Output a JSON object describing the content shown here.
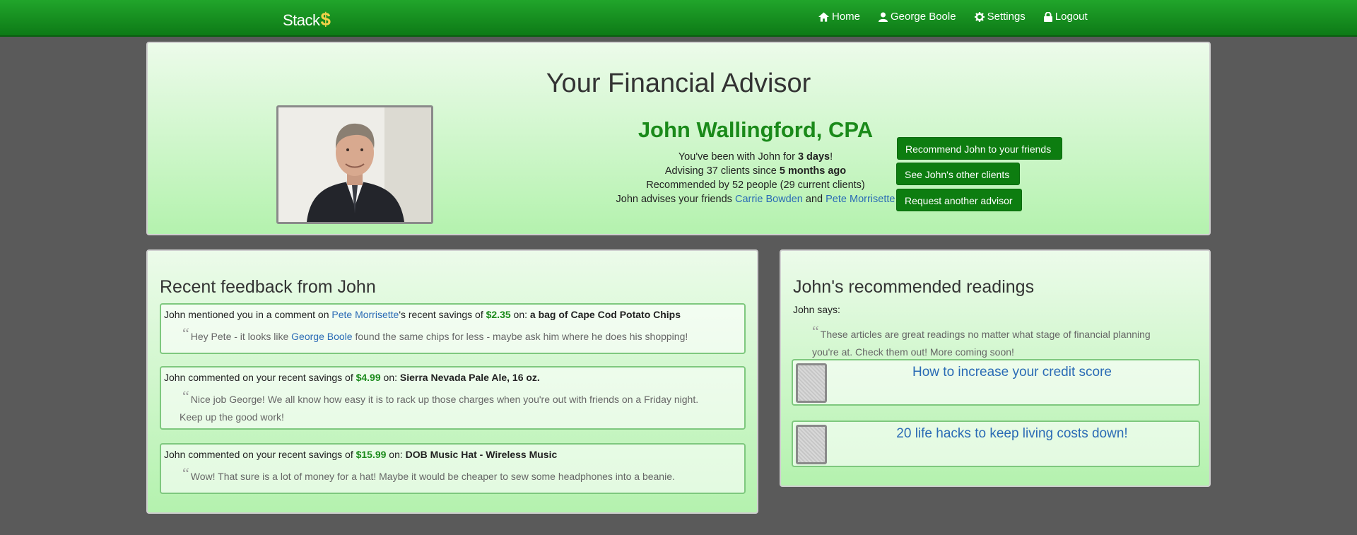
{
  "nav": {
    "brand_text": "Stack",
    "brand_symbol": "$",
    "items": [
      {
        "label": "Home",
        "icon": "home-icon"
      },
      {
        "label": "George Boole",
        "icon": "user-icon"
      },
      {
        "label": "Settings",
        "icon": "gear-icon"
      },
      {
        "label": "Logout",
        "icon": "lock-icon"
      }
    ]
  },
  "hero": {
    "title": "Your Financial Advisor",
    "advisor_name": "John Wallingford, CPA",
    "line1_pre": "You've been with John for ",
    "line1_bold": "3 days",
    "line1_post": "!",
    "line2_pre": "Advising 37 clients since ",
    "line2_bold": "5 months ago",
    "line3": "Recommended by 52 people (29 current clients)",
    "line4_pre": "John advises your friends ",
    "friend1": "Carrie Bowden",
    "line4_and": " and ",
    "friend2": "Pete Morrisette",
    "buttons": {
      "recommend": "Recommend John to your friends",
      "other_clients": "See John's other clients",
      "request": "Request another advisor"
    }
  },
  "feedback": {
    "title": "Recent feedback from John",
    "items": [
      {
        "pre": "John mentioned you in a comment on ",
        "link": "Pete Morrisette",
        "mid": "'s recent savings of ",
        "amount": "$2.35",
        "on": " on: ",
        "product": "a bag of Cape Cod Potato Chips",
        "quote_pre": "Hey Pete - it looks like ",
        "quote_link": "George Boole",
        "quote_post": " found the same chips for less - maybe ask him where he does his shopping!"
      },
      {
        "pre": "John commented on your recent savings of ",
        "amount": "$4.99",
        "on": " on: ",
        "product": "Sierra Nevada Pale Ale, 16 oz.",
        "quote_line1": "Nice job George! We all know how easy it is to rack up those charges when you're out with friends on a Friday night.",
        "quote_line2": "Keep up the good work!"
      },
      {
        "pre": "John commented on your recent savings of ",
        "amount": "$15.99",
        "on": " on: ",
        "product": "DOB Music Hat - Wireless Music",
        "quote": "Wow! That sure is a lot of money for a hat! Maybe it would be cheaper to sew some headphones into a beanie."
      }
    ]
  },
  "readings": {
    "title": "John's recommended readings",
    "says": "John says:",
    "quote": "These articles are great readings no matter what stage of financial planning you're at. Check them out! More coming soon!",
    "articles": [
      {
        "title": "How to increase your credit score"
      },
      {
        "title": "20 life hacks to keep living costs down!"
      }
    ]
  },
  "colors": {
    "nav_green": "#14901e",
    "brand_gold": "#f2d24a",
    "button_green": "#0d7d10",
    "amount_green": "#1a8a1a",
    "link_blue": "#2a6bb5",
    "background": "#5a5a5a"
  }
}
